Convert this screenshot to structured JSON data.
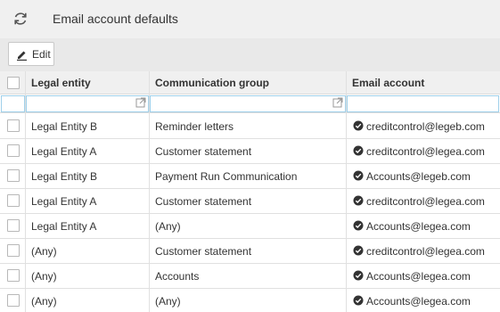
{
  "header": {
    "title": "Email account defaults",
    "refresh_icon": "refresh-icon"
  },
  "toolbar": {
    "edit_label": "Edit",
    "edit_icon": "pencil-icon"
  },
  "grid": {
    "columns": {
      "legal_entity": "Legal entity",
      "communication_group": "Communication group",
      "email_account": "Email account"
    },
    "filters": {
      "legal_entity": "",
      "communication_group": "",
      "email_account": ""
    },
    "rows": [
      {
        "legal_entity": "Legal Entity B",
        "communication_group": "Reminder letters",
        "email_account": "creditcontrol@legeb.com"
      },
      {
        "legal_entity": "Legal Entity A",
        "communication_group": "Customer statement",
        "email_account": "creditcontrol@legea.com"
      },
      {
        "legal_entity": "Legal Entity B",
        "communication_group": "Payment Run Communication",
        "email_account": "Accounts@legeb.com"
      },
      {
        "legal_entity": "Legal Entity A",
        "communication_group": "Customer statement",
        "email_account": "creditcontrol@legea.com"
      },
      {
        "legal_entity": "Legal Entity A",
        "communication_group": "(Any)",
        "email_account": "Accounts@legea.com"
      },
      {
        "legal_entity": "(Any)",
        "communication_group": "Customer statement",
        "email_account": "creditcontrol@legea.com"
      },
      {
        "legal_entity": "(Any)",
        "communication_group": "Accounts",
        "email_account": "Accounts@legea.com"
      },
      {
        "legal_entity": "(Any)",
        "communication_group": "(Any)",
        "email_account": "Accounts@legea.com"
      }
    ],
    "status_icon": "check-circle-icon"
  },
  "colors": {
    "filter_border": "#9fd0ea",
    "header_bg": "#f0f0f0",
    "toolbar_bg": "#e9e9e9"
  }
}
